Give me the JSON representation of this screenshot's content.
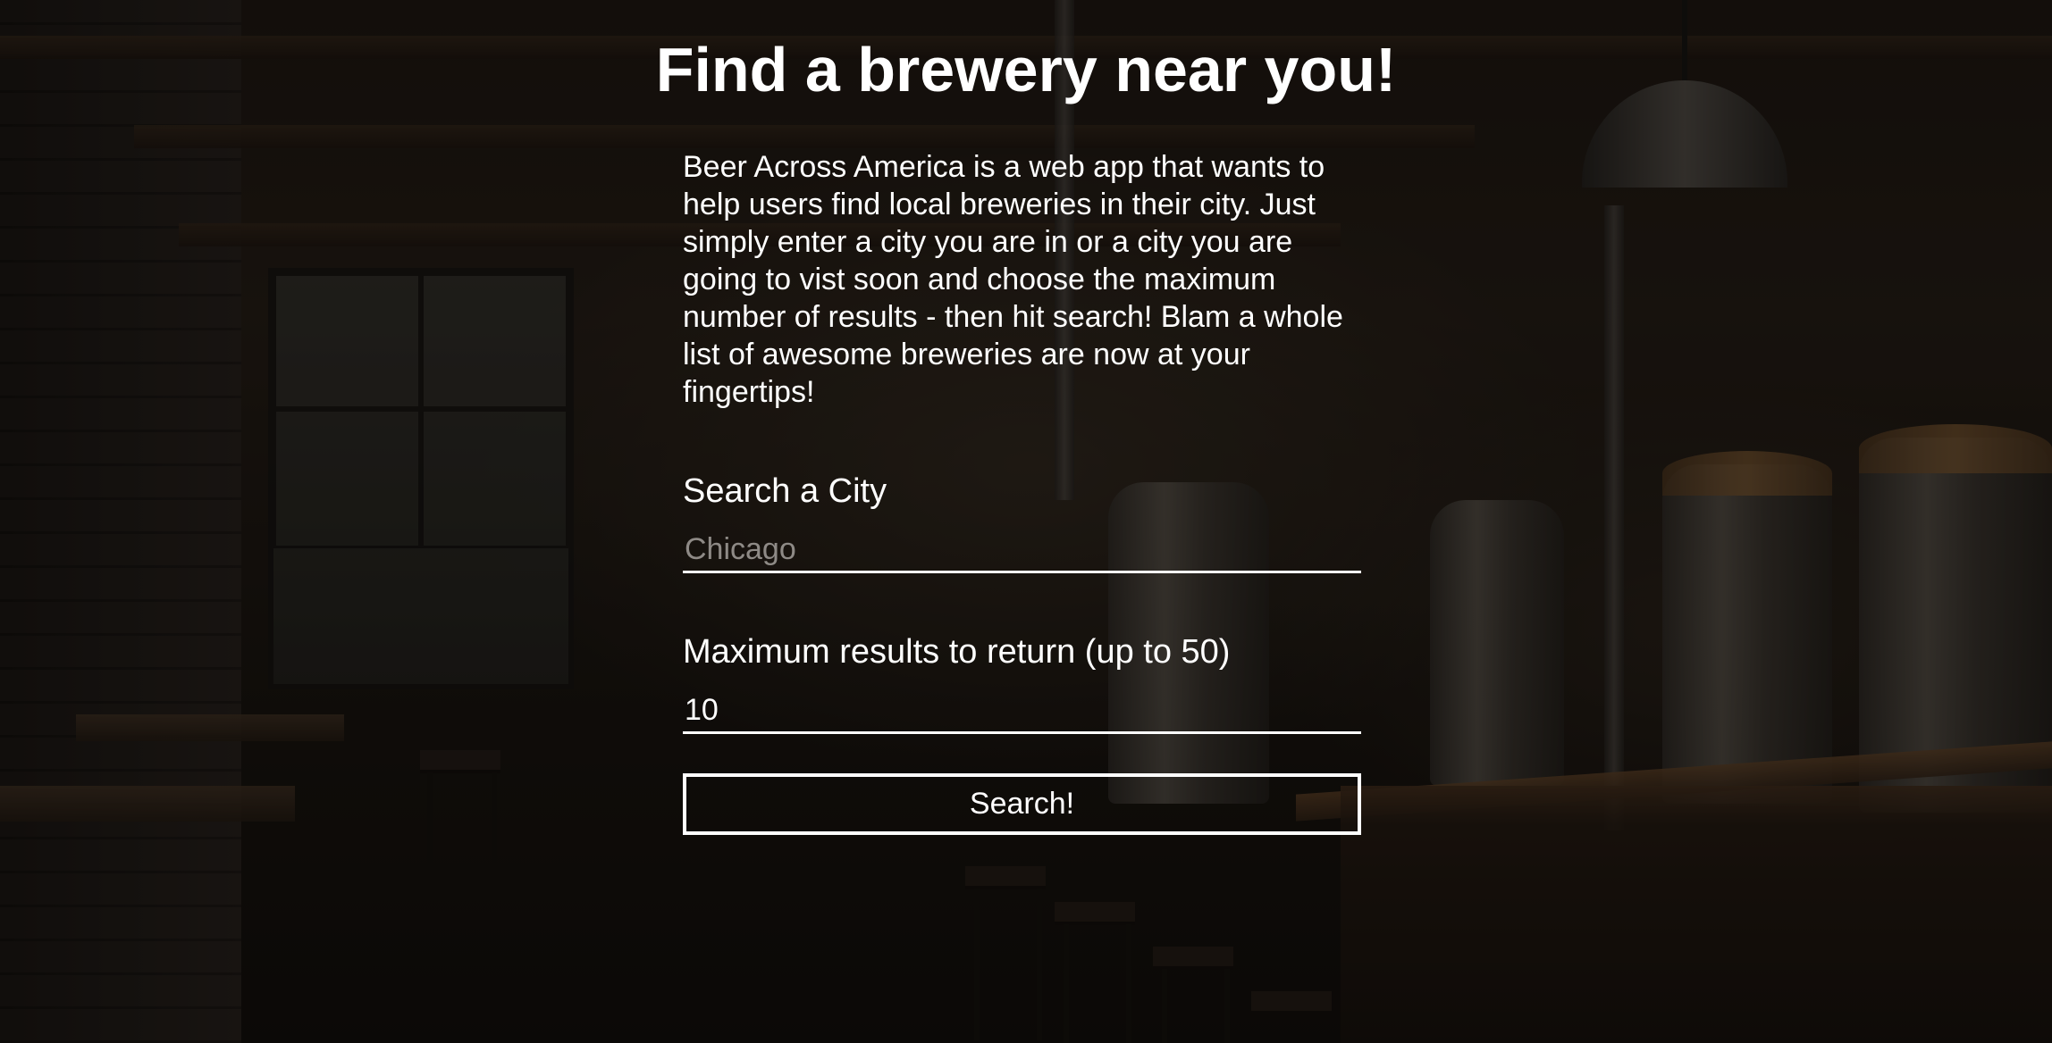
{
  "header": {
    "title": "Find a brewery near you!"
  },
  "intro": {
    "text": "Beer Across America is a web app that wants to help users find local breweries in their city. Just simply enter a city you are in or a city you are going to vist soon and choose the maximum number of results - then hit search! Blam a whole list of awesome breweries are now at your fingertips!"
  },
  "form": {
    "city": {
      "label": "Search a City",
      "placeholder": "Chicago",
      "value": ""
    },
    "max_results": {
      "label": "Maximum results to return (up to 50)",
      "value": "10"
    },
    "search_button_label": "Search!"
  },
  "colors": {
    "text": "#ffffff",
    "placeholder": "#8e8a86",
    "overlay": "rgba(0,0,0,0.45)"
  }
}
